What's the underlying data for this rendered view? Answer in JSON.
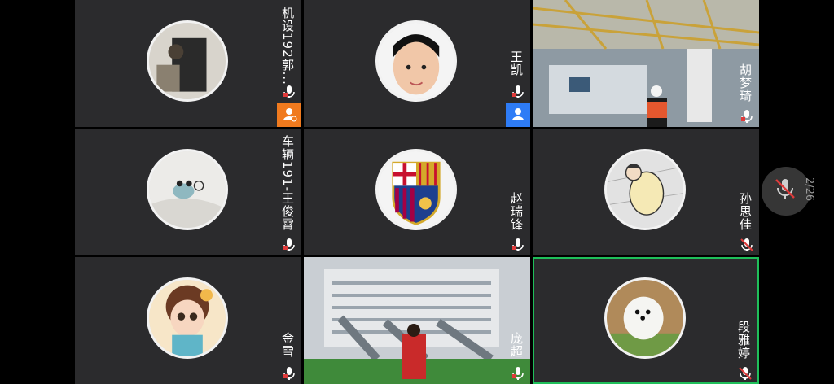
{
  "participants": [
    {
      "name": "机设192郭...",
      "role": "assistant",
      "mic": "on"
    },
    {
      "name": "王凯",
      "role": "host",
      "mic": "on"
    },
    {
      "name": "胡梦琦",
      "role": null,
      "mic": "on"
    },
    {
      "name": "车辆191-王俊霄",
      "role": null,
      "mic": "on"
    },
    {
      "name": "赵瑞锋",
      "role": null,
      "mic": "on"
    },
    {
      "name": "孙思佳",
      "role": null,
      "mic": "muted"
    },
    {
      "name": "金雪",
      "role": null,
      "mic": "on"
    },
    {
      "name": "庞超",
      "role": null,
      "mic": "on"
    },
    {
      "name": "段雅婷",
      "role": null,
      "mic": "muted"
    }
  ],
  "page_indicator": "2/26",
  "colors": {
    "tile_bg": "#2b2b2d",
    "assistant_badge": "#f07a1e",
    "host_badge": "#2e7cf6",
    "active_border": "#1fbf5a",
    "mic_red": "#e03b3b"
  },
  "icons": {
    "mic_on": "mic-icon",
    "mic_muted": "mic-muted-icon",
    "assistant": "person-assistant-icon",
    "host": "person-host-icon"
  }
}
